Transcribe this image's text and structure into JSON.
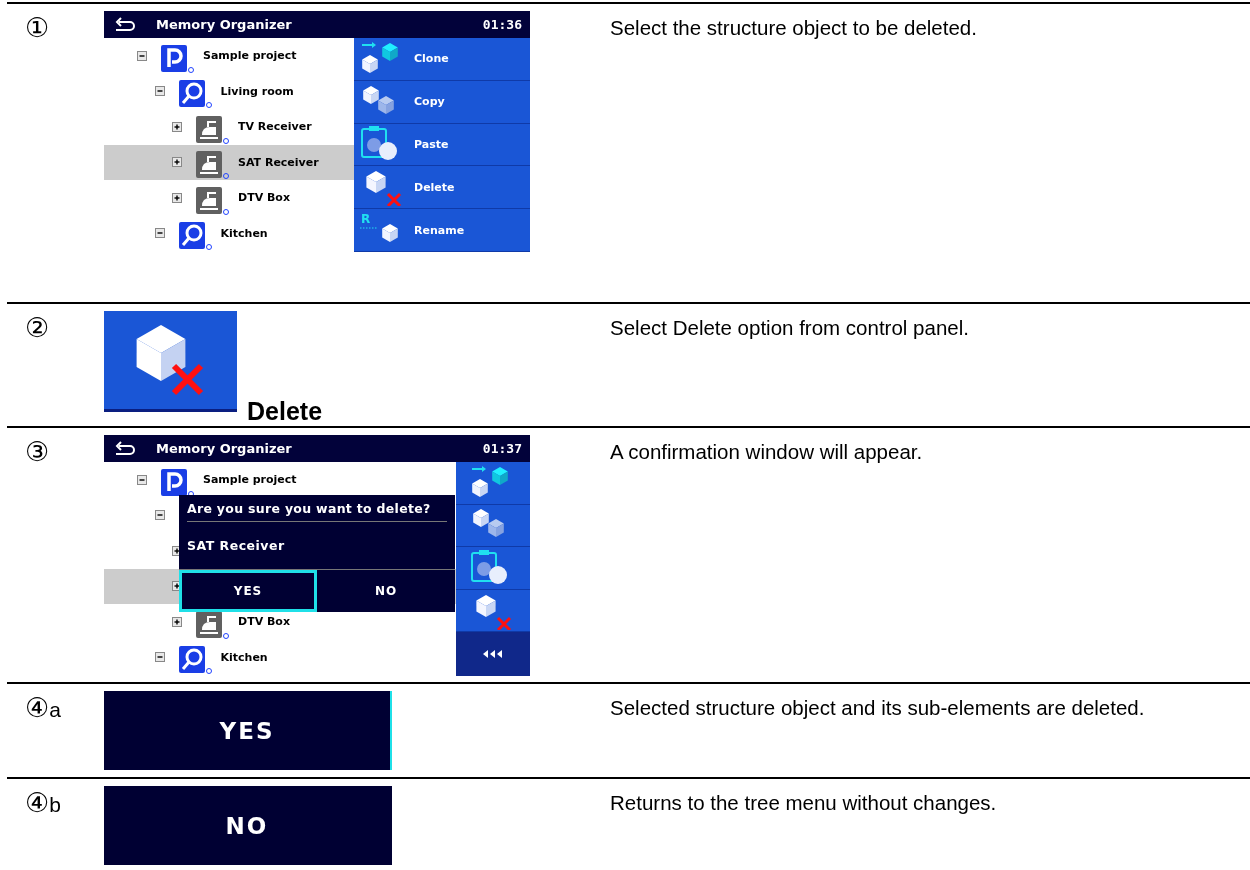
{
  "steps": [
    {
      "marker": "①",
      "description": "Select the structure object to be deleted.",
      "screen": {
        "kind": "tree_screen",
        "title": "Memory Organizer",
        "time": "01:36",
        "tree": [
          {
            "kind": "project",
            "label": "Sample project",
            "expanded": true,
            "selected": false,
            "children": [
              {
                "kind": "location",
                "label": "Living room",
                "expanded": true,
                "selected": false,
                "children": [
                  {
                    "kind": "device",
                    "label": "TV Receiver",
                    "expanded": false,
                    "selected": false
                  },
                  {
                    "kind": "device",
                    "label": "SAT Receiver",
                    "expanded": false,
                    "selected": true
                  },
                  {
                    "kind": "device",
                    "label": "DTV Box",
                    "expanded": false,
                    "selected": false
                  }
                ]
              },
              {
                "kind": "location",
                "label": "Kitchen",
                "expanded": true,
                "selected": false
              }
            ]
          }
        ],
        "panel": {
          "kind": "wide",
          "items": [
            {
              "kind": "clone",
              "label": "Clone"
            },
            {
              "kind": "copy",
              "label": "Copy"
            },
            {
              "kind": "paste",
              "label": "Paste"
            },
            {
              "kind": "delete",
              "label": "Delete"
            },
            {
              "kind": "rename",
              "label": "Rename",
              "badge": "R"
            }
          ]
        }
      }
    },
    {
      "marker": "②",
      "description": "Select Delete option from control panel.",
      "screen": {
        "kind": "icon_button",
        "label": "Delete"
      }
    },
    {
      "marker": "③",
      "description": "A confirmation window will appear.",
      "screen": {
        "kind": "tree_screen",
        "title": "Memory Organizer",
        "time": "01:37",
        "tree": [
          {
            "kind": "project",
            "label": "Sample project",
            "expanded": true,
            "selected": false,
            "children": [
              {
                "expanded": true,
                "selected": false,
                "children": [
                  {
                    "expanded": false,
                    "selected": false
                  },
                  {
                    "expanded": false,
                    "selected": true
                  },
                  {
                    "kind": "device",
                    "label": "DTV Box",
                    "expanded": false,
                    "selected": false
                  }
                ]
              },
              {
                "kind": "location",
                "label": "Kitchen",
                "expanded": true,
                "selected": false
              }
            ]
          }
        ],
        "panel": {
          "kind": "narrow",
          "items": [
            {
              "kind": "clone"
            },
            {
              "kind": "copy"
            },
            {
              "kind": "paste"
            },
            {
              "kind": "delete"
            },
            {
              "kind": "back"
            }
          ]
        },
        "dialog": {
          "title": "Are you sure you want to delete?",
          "item": "SAT Receiver",
          "buttons": [
            {
              "label": "YES",
              "selected": true
            },
            {
              "label": "NO",
              "selected": false
            }
          ]
        }
      }
    },
    {
      "marker": "④",
      "suffix": "a",
      "description": "Selected structure object and its sub-elements are deleted.",
      "screen": {
        "kind": "dialog_button",
        "label": "YES",
        "selected": true
      }
    },
    {
      "marker": "④",
      "suffix": "b",
      "description": "Returns to the tree menu without changes.",
      "screen": {
        "kind": "dialog_button",
        "label": "NO",
        "selected": false
      }
    }
  ]
}
